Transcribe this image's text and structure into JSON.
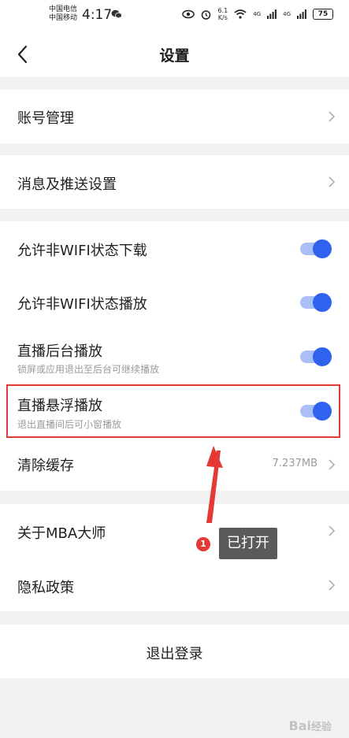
{
  "status_bar": {
    "carrier_1": "中国电信",
    "carrier_2": "中国移动",
    "time": "4:17",
    "net_speed": "6.1\nK/s",
    "signal_1": "4G",
    "signal_2": "4G",
    "battery": "75"
  },
  "nav": {
    "title": "设置",
    "back_icon": "chevron-left"
  },
  "groups": {
    "account": {
      "label": "账号管理"
    },
    "push": {
      "label": "消息及推送设置"
    },
    "toggles": [
      {
        "label": "允许非WIFI状态下载",
        "sub": "",
        "on": true
      },
      {
        "label": "允许非WIFI状态播放",
        "sub": "",
        "on": true
      },
      {
        "label": "直播后台播放",
        "sub": "锁屏或应用退出至后台可继续播放",
        "on": true
      },
      {
        "label": "直播悬浮播放",
        "sub": "退出直播间后可小窗播放",
        "on": true
      }
    ],
    "cache": {
      "label": "清除缓存",
      "value": "7.237MB"
    },
    "about": {
      "label": "关于MBA大师"
    },
    "privacy": {
      "label": "隐私政策"
    },
    "logout": {
      "label": "退出登录"
    }
  },
  "annotation": {
    "step_number": "1",
    "tooltip": "已打开"
  },
  "watermark": "Bai经验",
  "colors": {
    "accent": "#2f63ef",
    "toggle_track": "#a9bff5",
    "highlight": "#e53935",
    "background": "#f2f2f2"
  }
}
